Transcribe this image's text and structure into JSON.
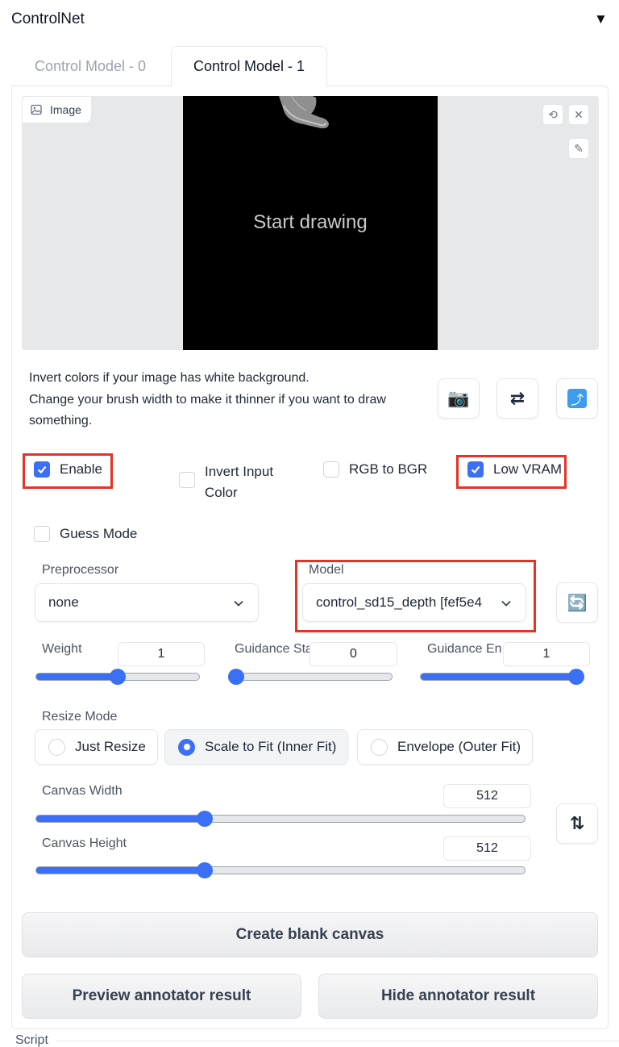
{
  "panel": {
    "title": "ControlNet",
    "collapse_icon": "triangle-down-icon"
  },
  "tabs": [
    {
      "label": "Control Model - 0",
      "active": false
    },
    {
      "label": "Control Model - 1",
      "active": true
    }
  ],
  "image": {
    "label": "Image",
    "placeholder": "Start drawing",
    "tools": [
      "undo-icon",
      "close-icon",
      "brush-icon"
    ]
  },
  "hint": {
    "line1": "Invert colors if your image has white background.",
    "line2": "Change your brush width to make it thinner if you want to draw something."
  },
  "tool_buttons": {
    "camera": "📷",
    "swap": "⇄",
    "upload": "⤴"
  },
  "checkboxes": {
    "enable": {
      "label": "Enable",
      "checked": true
    },
    "invert_input_color": {
      "label": "Invert Input Color",
      "checked": false
    },
    "rgb_to_bgr": {
      "label": "RGB to BGR",
      "checked": false
    },
    "low_vram": {
      "label": "Low VRAM",
      "checked": true
    },
    "guess_mode": {
      "label": "Guess Mode",
      "checked": false
    }
  },
  "preprocessor": {
    "label": "Preprocessor",
    "value": "none"
  },
  "model": {
    "label": "Model",
    "value": "control_sd15_depth [fef5e4"
  },
  "refresh_icon": "🔄",
  "sliders": {
    "weight": {
      "label": "Weight",
      "value": "1",
      "fraction": 0.5
    },
    "guidance_start": {
      "label": "Guidance Sta",
      "value": "0",
      "fraction": 0.0
    },
    "guidance_end": {
      "label": "Guidance En",
      "value": "1",
      "fraction": 1.0
    },
    "canvas_width": {
      "label": "Canvas Width",
      "value": "512",
      "fraction": 0.34
    },
    "canvas_height": {
      "label": "Canvas Height",
      "value": "512",
      "fraction": 0.34
    }
  },
  "resize_mode": {
    "label": "Resize Mode",
    "options": [
      {
        "label": "Just Resize",
        "selected": false
      },
      {
        "label": "Scale to Fit (Inner Fit)",
        "selected": true
      },
      {
        "label": "Envelope (Outer Fit)",
        "selected": false
      }
    ]
  },
  "swap_dims_icon": "⇅",
  "buttons": {
    "create_blank_canvas": "Create blank canvas",
    "preview_annotator": "Preview annotator result",
    "hide_annotator": "Hide annotator result"
  },
  "footer": {
    "script_label": "Script"
  },
  "colors": {
    "accent": "#3b6ff5",
    "highlight_box": "#e53328"
  }
}
